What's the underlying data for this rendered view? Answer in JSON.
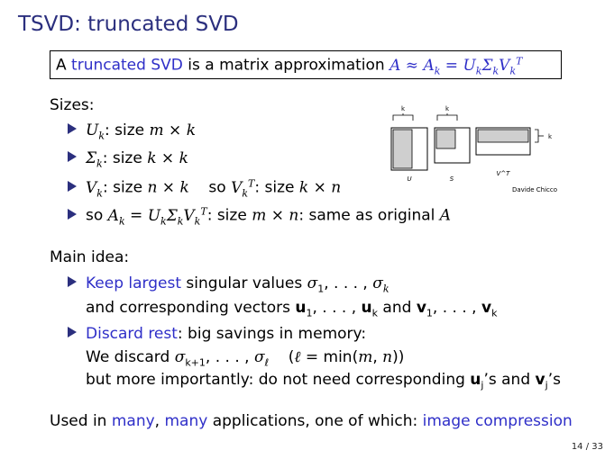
{
  "title": "TSVD: truncated SVD",
  "definition": {
    "prefix": "A",
    "highlight": "truncated SVD",
    "mid": "is a matrix approximation",
    "formula": "A ≈ A_k = U_k Σ_k V_k^T"
  },
  "sizes": {
    "heading": "Sizes:",
    "items": [
      "U_k: size m × k",
      "Σ_k: size k × k",
      "V_k: size n × k    so V_k^T: size k × n",
      "so A_k = U_k Σ_k V_k^T: size m × n: same as original A"
    ]
  },
  "diagram": {
    "labels": [
      "k",
      "k",
      "k",
      "U",
      "S",
      "V^T"
    ],
    "credit": "Davide Chicco"
  },
  "main_idea": {
    "heading": "Main idea:",
    "point1_highlight": "Keep largest",
    "point1_text": "singular values σ1, . . . , σk",
    "point1_line2": "and corresponding vectors u1, . . . , uk and v1, . . . , vk",
    "point2_highlight": "Discard rest",
    "point2_text": ": big savings in memory:",
    "point2_line2": "We discard σk+1, . . . , σℓ    (ℓ = min(m, n))",
    "point2_line3": "but more importantly: do not need corresponding uj’s and vj’s"
  },
  "footer": {
    "prefix": "Used in",
    "link1": "many",
    "link2": "many",
    "mid": "applications, one of which:",
    "link3": "image compression"
  },
  "page_number": "14 / 33"
}
